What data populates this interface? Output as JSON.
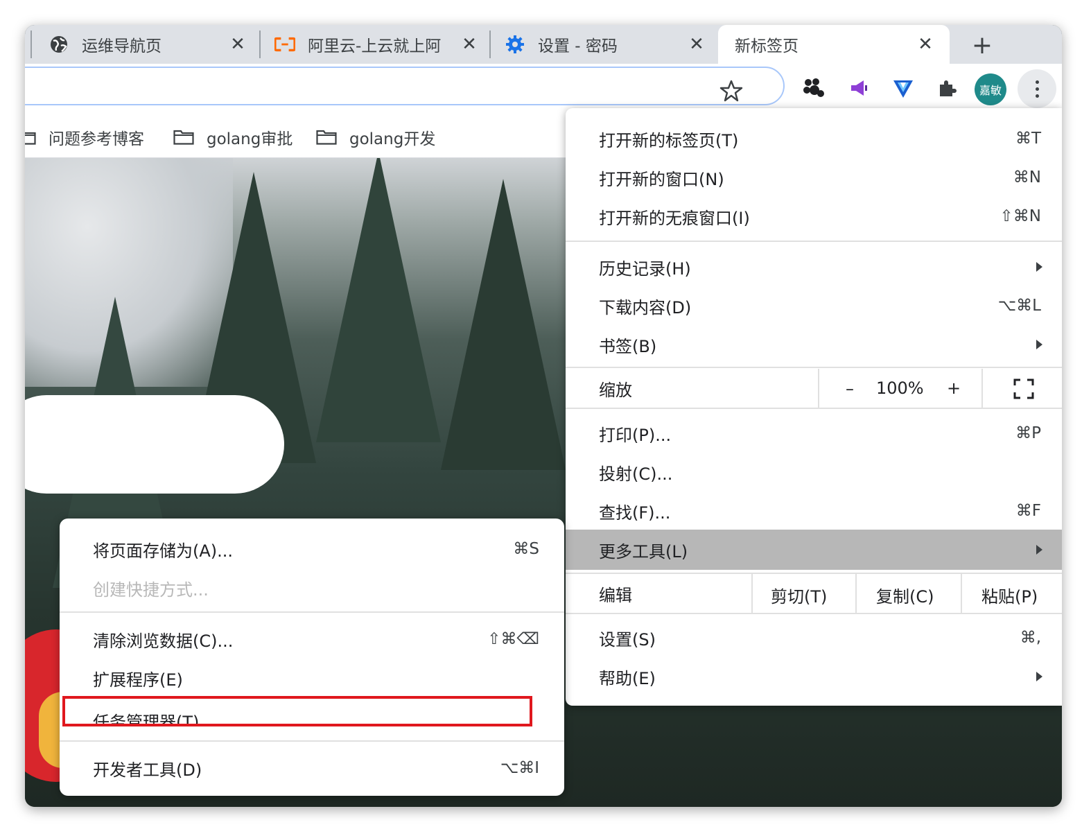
{
  "tabs": [
    {
      "title": "运维导航页",
      "icon": "globe-icon",
      "active": false
    },
    {
      "title": "阿里云-上云就上阿",
      "icon": "aliyun-logo-icon",
      "active": false
    },
    {
      "title": "设置 - 密码",
      "icon": "gear-icon",
      "active": false
    },
    {
      "title": "新标签页",
      "icon": "",
      "active": true
    }
  ],
  "toolbar": {
    "avatar_text": "嘉敏",
    "extensions": [
      "extension-paw-icon",
      "extension-megaphone-icon",
      "extension-v-shield-icon",
      "extensions-puzzle-icon"
    ]
  },
  "bookmarks": [
    {
      "label": "问题参考博客"
    },
    {
      "label": "golang审批"
    },
    {
      "label": "golang开发"
    }
  ],
  "menu": {
    "items": [
      {
        "label": "打开新的标签页(T)",
        "shortcut": "⌘T"
      },
      {
        "label": "打开新的窗口(N)",
        "shortcut": "⌘N"
      },
      {
        "label": "打开新的无痕窗口(I)",
        "shortcut": "⇧⌘N"
      },
      {
        "label": "历史记录(H)",
        "shortcut": ""
      },
      {
        "label": "下载内容(D)",
        "shortcut": "⌥⌘L"
      },
      {
        "label": "书签(B)",
        "shortcut": ""
      },
      {
        "label": "打印(P)...",
        "shortcut": "⌘P"
      },
      {
        "label": "投射(C)...",
        "shortcut": ""
      },
      {
        "label": "查找(F)...",
        "shortcut": "⌘F"
      },
      {
        "label": "更多工具(L)",
        "shortcut": ""
      },
      {
        "label": "设置(S)",
        "shortcut": "⌘,"
      },
      {
        "label": "帮助(E)",
        "shortcut": ""
      }
    ],
    "zoom": {
      "label": "缩放",
      "minus": "–",
      "value": "100%",
      "plus": "+"
    },
    "edit": {
      "label": "编辑",
      "cut": "剪切(T)",
      "copy": "复制(C)",
      "paste": "粘贴(P)"
    }
  },
  "submenu": {
    "items": [
      {
        "label": "将页面存储为(A)...",
        "shortcut": "⌘S"
      },
      {
        "label": "创建快捷方式...",
        "shortcut": ""
      },
      {
        "label": "清除浏览数据(C)...",
        "shortcut": "⇧⌘⌫"
      },
      {
        "label": "扩展程序(E)",
        "shortcut": ""
      },
      {
        "label": "任务管理器(T)",
        "shortcut": ""
      },
      {
        "label": "开发者工具(D)",
        "shortcut": "⌥⌘I"
      }
    ]
  },
  "colors": {
    "highlight_box": "#e0181e",
    "menu_hover": "#b7b7b7",
    "avatar_bg": "#1f8a8a",
    "aliyun_orange": "#ff6a00",
    "gear_blue": "#1a73e8"
  }
}
